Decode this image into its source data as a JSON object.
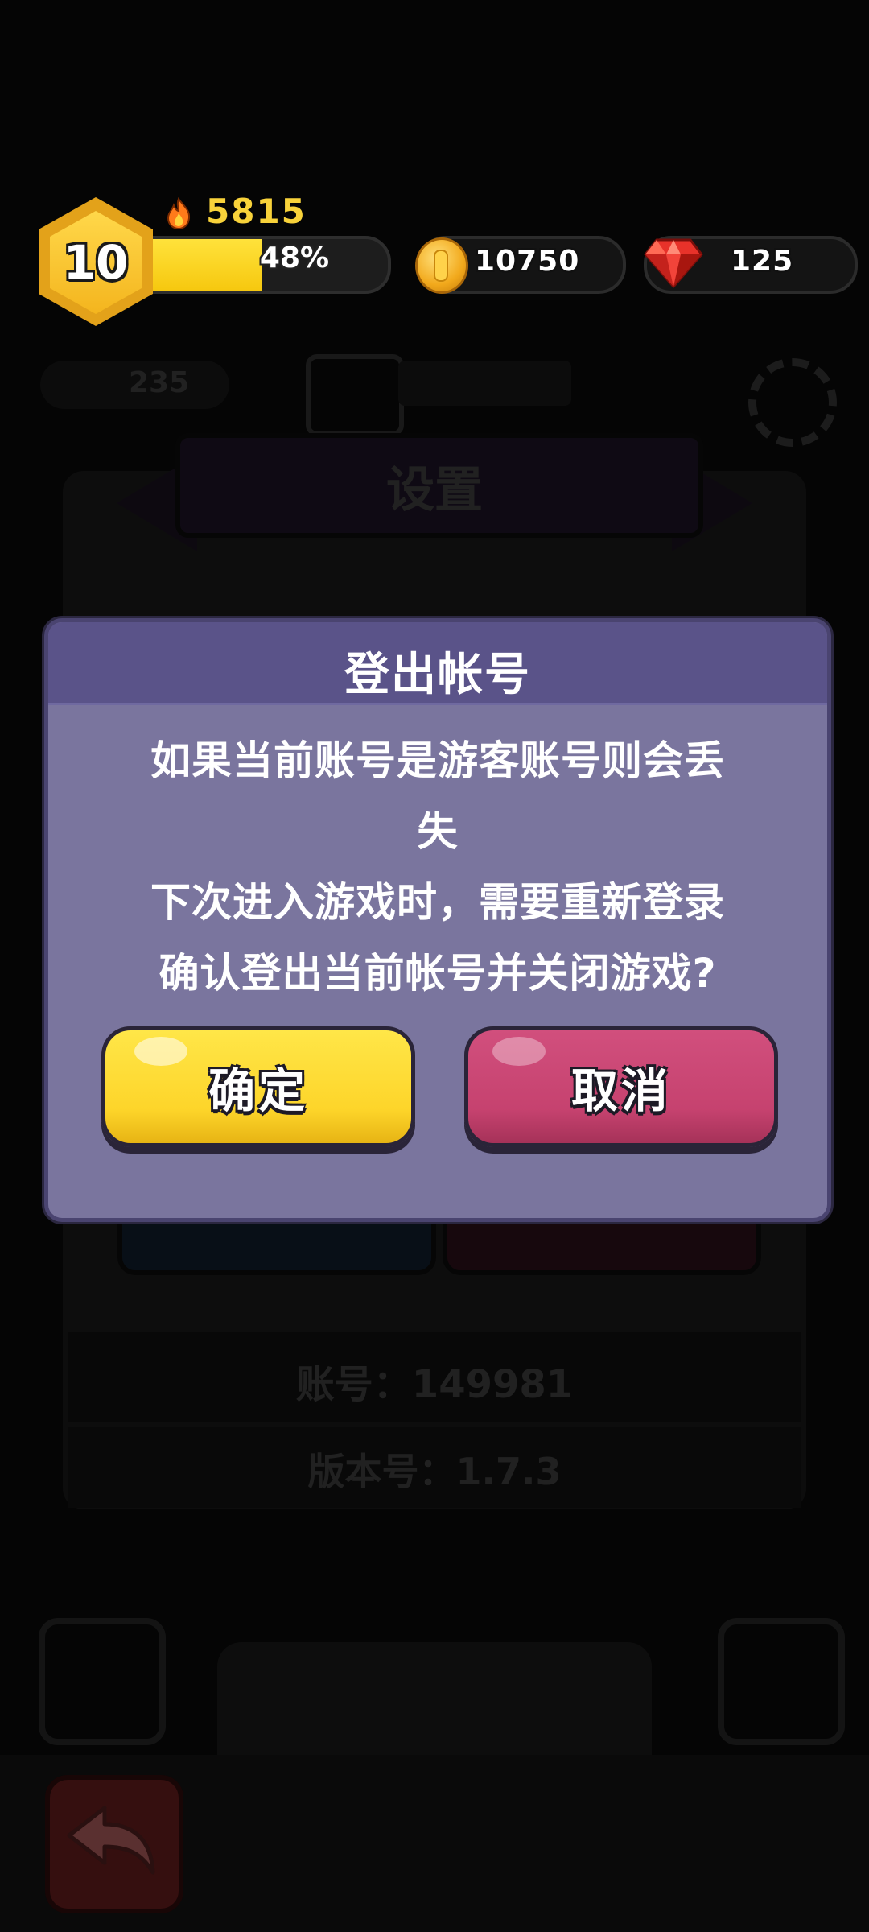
{
  "hud": {
    "level": "10",
    "power": "5815",
    "xp_percent_label": "48%",
    "xp_fraction": 0.48,
    "coins": "10750",
    "gems": "125"
  },
  "background": {
    "stat_value": "235",
    "settings_title": "设置",
    "account_label": "账号：149981",
    "version_label": "版本号：1.7.3"
  },
  "dialog": {
    "title": "登出帐号",
    "message_lines": [
      "如果当前账号是游客账号则会丢",
      "失",
      "下次进入游戏时，需要重新登录",
      "确认登出当前帐号并关闭游戏?"
    ],
    "confirm_label": "确定",
    "cancel_label": "取消"
  },
  "colors": {
    "dialog_bg": "#7a759e",
    "dialog_header": "#5a5389",
    "confirm_yellow": "#fdd52a",
    "cancel_pink": "#c6426f",
    "power_gold": "#f8d23a"
  },
  "icons": {
    "fire": "fire-icon",
    "coin": "coin-icon",
    "gem": "gem-icon",
    "back": "back-arrow-icon",
    "gear": "gear-icon"
  }
}
